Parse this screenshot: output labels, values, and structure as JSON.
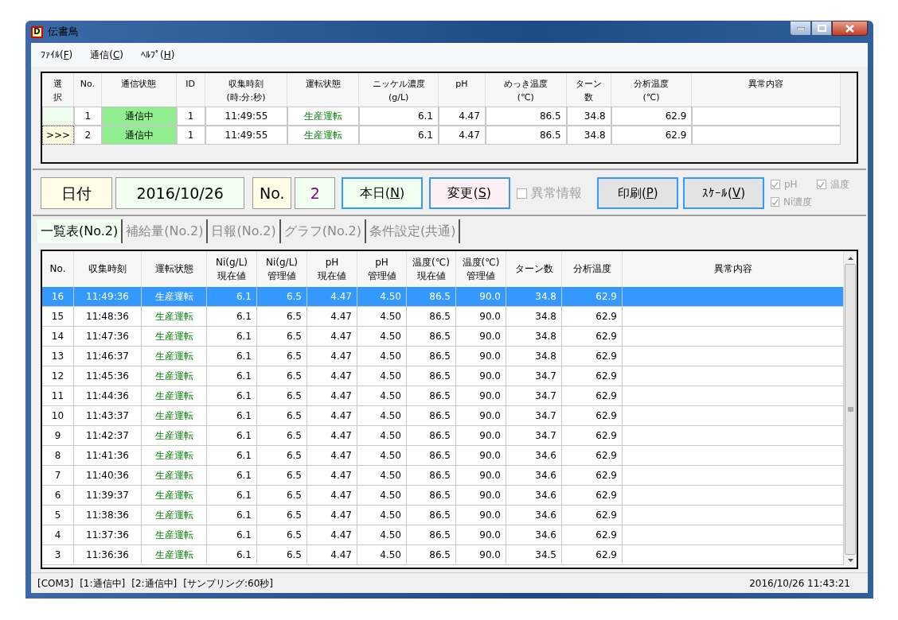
{
  "window": {
    "title": "伝書鳥",
    "app_icon": "D"
  },
  "menu": [
    {
      "prefix": "ﾌｧｲﾙ(",
      "access_key": "F",
      "suffix": ")"
    },
    {
      "prefix": "通信(",
      "access_key": "C",
      "suffix": ")"
    },
    {
      "prefix": "ﾍﾙﾌﾟ(",
      "access_key": "H",
      "suffix": ")"
    }
  ],
  "device_table": {
    "columns": [
      {
        "lines": [
          "選",
          "択"
        ],
        "kind": "select"
      },
      {
        "lines": [
          "No."
        ],
        "kind": "center"
      },
      {
        "lines": [
          "通信状態"
        ],
        "kind": "comm"
      },
      {
        "lines": [
          "ID"
        ],
        "kind": "center"
      },
      {
        "lines": [
          "収集時刻",
          "(時:分:秒)"
        ],
        "kind": "center"
      },
      {
        "lines": [
          "運転状態"
        ],
        "kind": "state"
      },
      {
        "lines": [
          "ニッケル濃度",
          "(g/L)"
        ],
        "kind": "number"
      },
      {
        "lines": [
          "pH"
        ],
        "kind": "number"
      },
      {
        "lines": [
          "めっき温度",
          "(℃)"
        ],
        "kind": "number"
      },
      {
        "lines": [
          "ターン",
          "数"
        ],
        "kind": "number"
      },
      {
        "lines": [
          "分析温度",
          "(℃)"
        ],
        "kind": "number"
      },
      {
        "lines": [
          "異常内容"
        ],
        "kind": "text"
      }
    ],
    "rows": [
      {
        "selected": false,
        "cells": [
          "",
          "1",
          "通信中",
          "1",
          "11:49:55",
          "生産運転",
          "6.1",
          "4.47",
          "86.5",
          "34.8",
          "62.9"
        ]
      },
      {
        "selected": true,
        "cells": [
          ">>>",
          "2",
          "通信中",
          "1",
          "11:49:55",
          "生産運転",
          "6.1",
          "4.47",
          "86.5",
          "34.8",
          "62.9"
        ]
      }
    ]
  },
  "controls": {
    "date_label": "日付",
    "date_value": "2016/10/26",
    "no_label": "No.",
    "no_value": "2",
    "buttons": [
      {
        "prefix": "本日(",
        "access_key": "N",
        "suffix": ")",
        "kind": "green"
      },
      {
        "prefix": "変更(",
        "access_key": "S",
        "suffix": ")",
        "kind": "pink"
      }
    ],
    "anomaly_checkbox": {
      "label": "異常情報",
      "checked": false,
      "disabled": true
    },
    "action_buttons": [
      {
        "prefix": "印刷(",
        "access_key": "P",
        "suffix": ")"
      },
      {
        "prefix": "ｽｹｰﾙ(",
        "access_key": "V",
        "suffix": ")"
      }
    ],
    "scale_options": [
      {
        "label": "pH",
        "checked": true,
        "disabled": true
      },
      {
        "label": "温度",
        "checked": true,
        "disabled": true
      },
      {
        "label": "Ni濃度",
        "checked": true,
        "disabled": true
      }
    ]
  },
  "tabs": [
    {
      "label": "一覧表(No.2)",
      "selected": true
    },
    {
      "label": "補給量(No.2)",
      "selected": false
    },
    {
      "label": "日報(No.2)",
      "selected": false
    },
    {
      "label": "グラフ(No.2)",
      "selected": false
    },
    {
      "label": "条件設定(共通)",
      "selected": false
    }
  ],
  "log_table": {
    "columns": [
      {
        "lines": [
          "No."
        ],
        "kind": "center"
      },
      {
        "lines": [
          "収集時刻"
        ],
        "kind": "center"
      },
      {
        "lines": [
          "運転状態"
        ],
        "kind": "state"
      },
      {
        "lines": [
          "Ni(g/L)",
          "現在値"
        ],
        "kind": "number"
      },
      {
        "lines": [
          "Ni(g/L)",
          "管理値"
        ],
        "kind": "number"
      },
      {
        "lines": [
          "pH",
          "現在値"
        ],
        "kind": "number"
      },
      {
        "lines": [
          "pH",
          "管理値"
        ],
        "kind": "number"
      },
      {
        "lines": [
          "温度(℃)",
          "現在値"
        ],
        "kind": "number"
      },
      {
        "lines": [
          "温度(℃)",
          "管理値"
        ],
        "kind": "number"
      },
      {
        "lines": [
          "ターン数"
        ],
        "kind": "number"
      },
      {
        "lines": [
          "分析温度"
        ],
        "kind": "number"
      },
      {
        "lines": [
          "異常内容"
        ],
        "kind": "text"
      }
    ],
    "rows": [
      {
        "selected": true,
        "cells": [
          "16",
          "11:49:36",
          "生産運転",
          "6.1",
          "6.5",
          "4.47",
          "4.50",
          "86.5",
          "90.0",
          "34.8",
          "62.9"
        ]
      },
      {
        "selected": false,
        "cells": [
          "15",
          "11:48:36",
          "生産運転",
          "6.1",
          "6.5",
          "4.47",
          "4.50",
          "86.5",
          "90.0",
          "34.8",
          "62.9"
        ]
      },
      {
        "selected": false,
        "cells": [
          "14",
          "11:47:36",
          "生産運転",
          "6.1",
          "6.5",
          "4.47",
          "4.50",
          "86.5",
          "90.0",
          "34.8",
          "62.9"
        ]
      },
      {
        "selected": false,
        "cells": [
          "13",
          "11:46:37",
          "生産運転",
          "6.1",
          "6.5",
          "4.47",
          "4.50",
          "86.5",
          "90.0",
          "34.8",
          "62.9"
        ]
      },
      {
        "selected": false,
        "cells": [
          "12",
          "11:45:36",
          "生産運転",
          "6.1",
          "6.5",
          "4.47",
          "4.50",
          "86.5",
          "90.0",
          "34.7",
          "62.9"
        ]
      },
      {
        "selected": false,
        "cells": [
          "11",
          "11:44:36",
          "生産運転",
          "6.1",
          "6.5",
          "4.47",
          "4.50",
          "86.5",
          "90.0",
          "34.7",
          "62.9"
        ]
      },
      {
        "selected": false,
        "cells": [
          "10",
          "11:43:37",
          "生産運転",
          "6.1",
          "6.5",
          "4.47",
          "4.50",
          "86.5",
          "90.0",
          "34.7",
          "62.9"
        ]
      },
      {
        "selected": false,
        "cells": [
          "9",
          "11:42:37",
          "生産運転",
          "6.1",
          "6.5",
          "4.47",
          "4.50",
          "86.5",
          "90.0",
          "34.7",
          "62.9"
        ]
      },
      {
        "selected": false,
        "cells": [
          "8",
          "11:41:36",
          "生産運転",
          "6.1",
          "6.5",
          "4.47",
          "4.50",
          "86.5",
          "90.0",
          "34.6",
          "62.9"
        ]
      },
      {
        "selected": false,
        "cells": [
          "7",
          "11:40:36",
          "生産運転",
          "6.1",
          "6.5",
          "4.47",
          "4.50",
          "86.5",
          "90.0",
          "34.6",
          "62.9"
        ]
      },
      {
        "selected": false,
        "cells": [
          "6",
          "11:39:37",
          "生産運転",
          "6.1",
          "6.5",
          "4.47",
          "4.50",
          "86.5",
          "90.0",
          "34.6",
          "62.9"
        ]
      },
      {
        "selected": false,
        "cells": [
          "5",
          "11:38:36",
          "生産運転",
          "6.1",
          "6.5",
          "4.47",
          "4.50",
          "86.5",
          "90.0",
          "34.6",
          "62.9"
        ]
      },
      {
        "selected": false,
        "cells": [
          "4",
          "11:37:36",
          "生産運転",
          "6.1",
          "6.5",
          "4.47",
          "4.50",
          "86.5",
          "90.0",
          "34.6",
          "62.9"
        ]
      },
      {
        "selected": false,
        "cells": [
          "3",
          "11:36:36",
          "生産運転",
          "6.1",
          "6.5",
          "4.47",
          "4.50",
          "86.5",
          "90.0",
          "34.5",
          "62.9"
        ]
      }
    ]
  },
  "status_bar": {
    "items": [
      "[COM3]",
      "[1:通信中]",
      "[2:通信中]",
      "[サンプリング:60秒]"
    ],
    "datetime": "2016/10/26 11:43:21"
  }
}
